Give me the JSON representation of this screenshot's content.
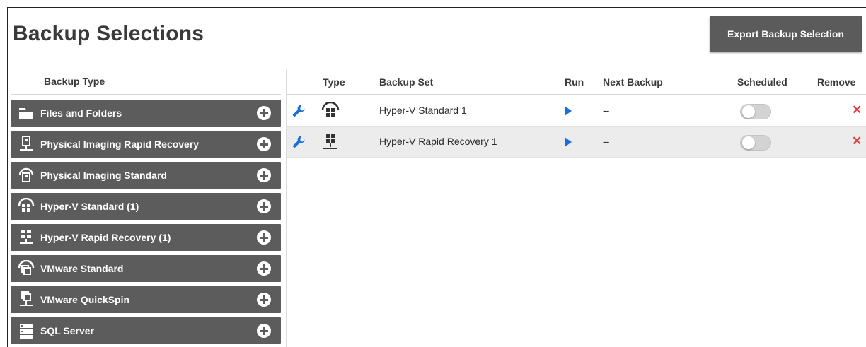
{
  "page": {
    "title": "Backup Selections"
  },
  "toolbar": {
    "export_label": "Export Backup Selection"
  },
  "left_panel": {
    "header": "Backup Type",
    "items": [
      {
        "label": "Files and Folders",
        "icon": "folder-icon"
      },
      {
        "label": "Physical Imaging Rapid Recovery",
        "icon": "physical-rapid-recovery-icon"
      },
      {
        "label": "Physical Imaging Standard",
        "icon": "physical-standard-icon"
      },
      {
        "label": "Hyper-V Standard (1)",
        "icon": "hyperv-standard-icon"
      },
      {
        "label": "Hyper-V Rapid Recovery (1)",
        "icon": "hyperv-rapid-recovery-icon"
      },
      {
        "label": "VMware Standard",
        "icon": "vmware-standard-icon"
      },
      {
        "label": "VMware QuickSpin",
        "icon": "vmware-quickspin-icon"
      },
      {
        "label": "SQL Server",
        "icon": "sql-server-icon"
      }
    ]
  },
  "table": {
    "columns": {
      "type": "Type",
      "backup_set": "Backup Set",
      "run": "Run",
      "next_backup": "Next Backup",
      "scheduled": "Scheduled",
      "remove": "Remove"
    },
    "rows": [
      {
        "backup_set": "Hyper-V Standard 1",
        "next_backup": "--",
        "scheduled": false,
        "remove_glyph": "✕",
        "type_icon": "hyperv-standard-icon"
      },
      {
        "backup_set": "Hyper-V Rapid Recovery 1",
        "next_backup": "--",
        "scheduled": false,
        "remove_glyph": "✕",
        "type_icon": "hyperv-rapid-recovery-icon"
      }
    ]
  },
  "colors": {
    "button_bg": "#5b5b5b",
    "item_bg": "#5c5c5c",
    "run_blue": "#1c6fd6",
    "remove_red": "#e23b3b",
    "row_alt": "#ececec"
  }
}
